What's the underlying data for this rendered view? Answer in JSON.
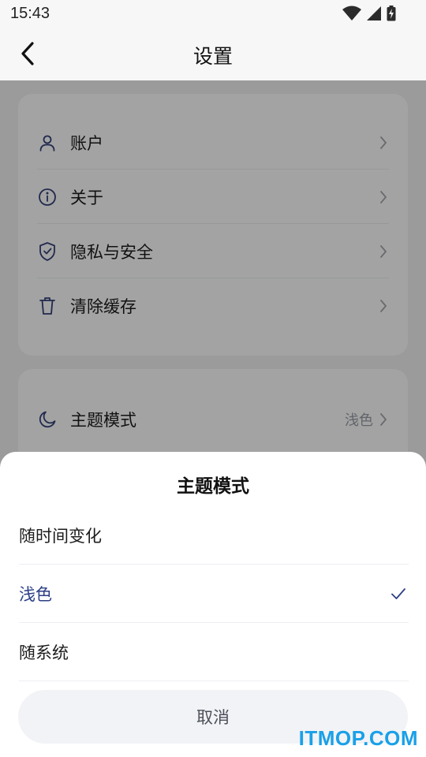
{
  "status_bar": {
    "time": "15:43",
    "icons": [
      "wifi-icon",
      "signal-icon",
      "battery-charging-icon"
    ]
  },
  "nav": {
    "title": "设置",
    "back_icon": "chevron-left-icon"
  },
  "settings": {
    "group1": [
      {
        "label": "账户",
        "icon": "user-icon"
      },
      {
        "label": "关于",
        "icon": "info-icon"
      },
      {
        "label": "隐私与安全",
        "icon": "shield-check-icon"
      },
      {
        "label": "清除缓存",
        "icon": "trash-icon"
      }
    ],
    "group2": [
      {
        "label": "主题模式",
        "value": "浅色",
        "icon": "moon-icon"
      }
    ]
  },
  "sheet": {
    "title": "主题模式",
    "options": [
      {
        "label": "随时间变化",
        "selected": false
      },
      {
        "label": "浅色",
        "selected": true
      },
      {
        "label": "随系统",
        "selected": false
      }
    ],
    "cancel_label": "取消"
  },
  "watermark": "ITMOP.COM",
  "colors": {
    "accent": "#2c3e86",
    "icon": "#34427a",
    "overlay": "rgba(0,0,0,0.36)",
    "watermark": "#1aa0e8"
  }
}
